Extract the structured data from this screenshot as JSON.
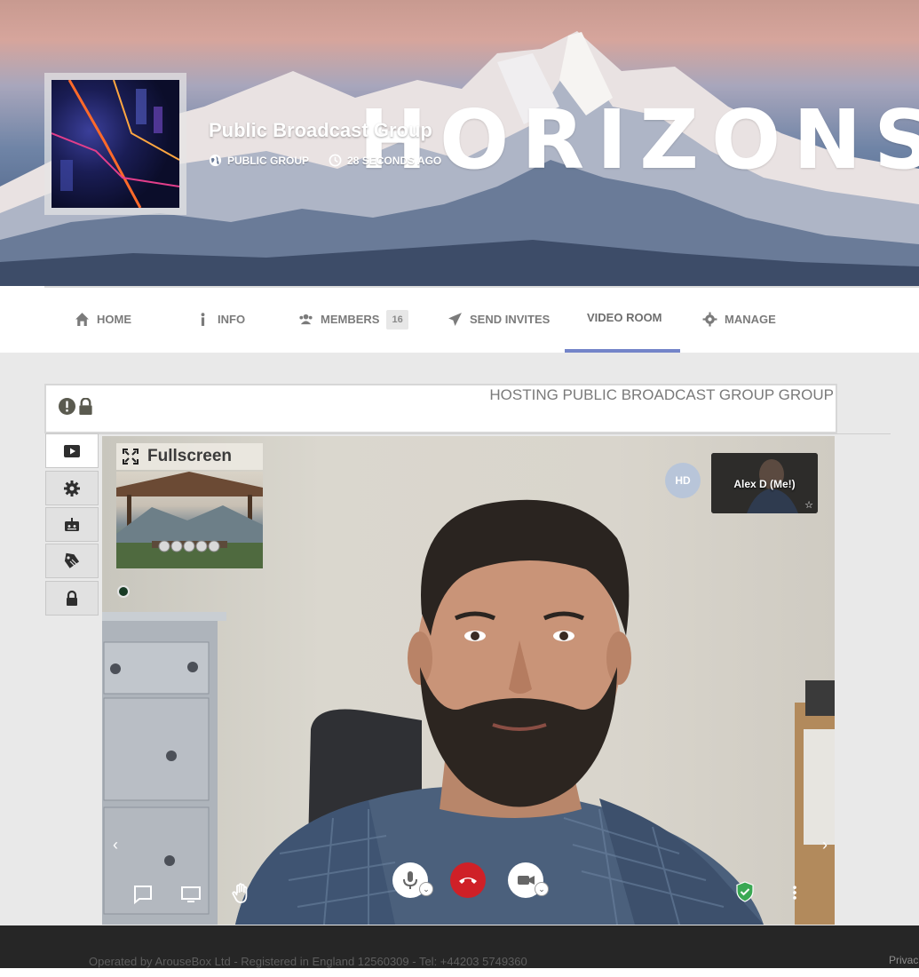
{
  "cover": {
    "brand_text": "HORIZONS",
    "group_title": "Public Broadcast Group",
    "privacy": "PUBLIC GROUP",
    "updated": "28 SECONDS AGO"
  },
  "nav": {
    "home": "HOME",
    "info": "INFO",
    "members": "MEMBERS",
    "members_count": "16",
    "send_invites": "SEND INVITES",
    "video_room": "VIDEO ROOM",
    "manage": "MANAGE",
    "active": "VIDEO ROOM"
  },
  "host": {
    "status": "HOSTING PUBLIC BROADCAST GROUP GROUP"
  },
  "side_tabs": [
    "play-icon",
    "gear-icon",
    "radio-icon",
    "tag-icon",
    "lock-icon"
  ],
  "video": {
    "fullscreen_label": "Fullscreen",
    "quality_badge": "HD",
    "self_name": "Alex D (Me!)"
  },
  "controls": [
    "chat-icon",
    "screen-share-icon",
    "raise-hand-icon",
    "microphone-icon",
    "hangup-icon",
    "camera-icon",
    "security-shield-icon",
    "more-options-icon"
  ],
  "colors": {
    "nav_active_underline": "#7485c9",
    "hangup_red": "#cf2027",
    "shield_green": "#3aa853",
    "footer_bg": "#262626"
  },
  "footer": {
    "legal": "Operated by ArouseBox Ltd - Registered in England 12560309 - Tel: +44203 5749360",
    "privacy_link": "Privac"
  }
}
